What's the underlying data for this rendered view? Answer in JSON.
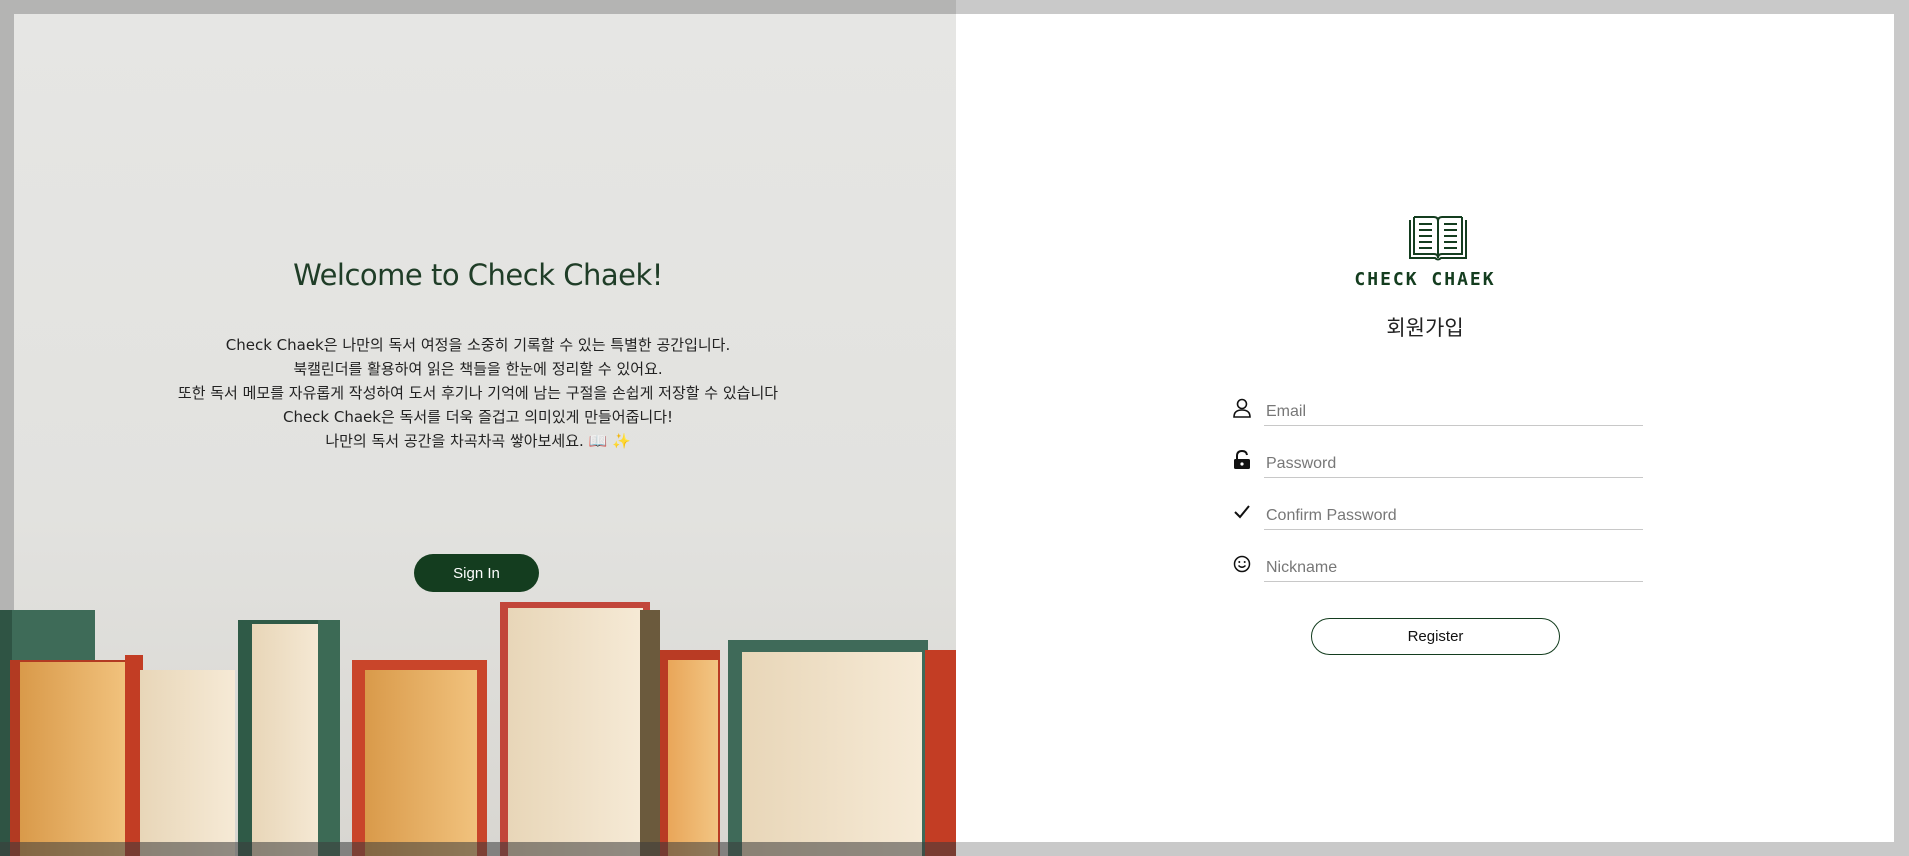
{
  "left_panel": {
    "welcome_title": "Welcome to Check Chaek!",
    "intro_lines": [
      "Check Chaek은 나만의 독서 여정을 소중히 기록할 수 있는 특별한 공간입니다.",
      "북캘린더를 활용하여 읽은 책들을 한눈에 정리할 수 있어요.",
      "또한 독서 메모를 자유롭게 작성하여 도서 후기나 기억에 남는 구절을 손쉽게 저장할 수 있습니다",
      "Check Chaek은 독서를 더욱 즐겁고 의미있게 만들어줍니다!",
      "나만의 독서 공간을 차곡차곡 쌓아보세요. 📖 ✨"
    ],
    "sign_in_label": "Sign In"
  },
  "right_panel": {
    "logo_text": "CHECK CHAEK",
    "logo_icon": "open-book-icon",
    "form_title": "회원가입",
    "fields": [
      {
        "icon": "user-icon",
        "placeholder": "Email",
        "value": ""
      },
      {
        "icon": "unlock-icon",
        "placeholder": "Password",
        "value": ""
      },
      {
        "icon": "check-icon",
        "placeholder": "Confirm Password",
        "value": ""
      },
      {
        "icon": "smile-icon",
        "placeholder": "Nickname",
        "value": ""
      }
    ],
    "register_label": "Register"
  },
  "colors": {
    "brand_green": "#143d1f",
    "title_green": "#1f3d27",
    "panel_bg": "#ffffff"
  }
}
